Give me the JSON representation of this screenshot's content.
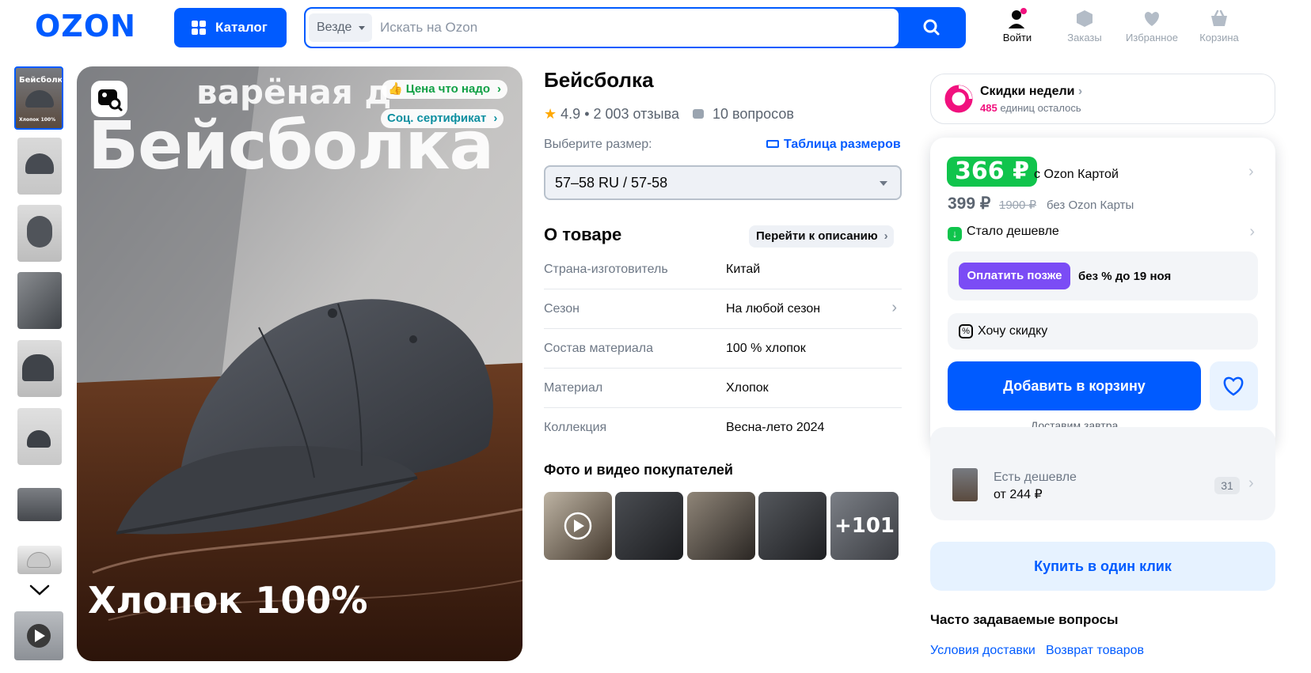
{
  "header": {
    "logo": "OZON",
    "catalog_label": "Каталог",
    "search_scope": "Везде",
    "search_placeholder": "Искать на Ozon",
    "login": "Войти",
    "orders": "Заказы",
    "favorites": "Избранное",
    "cart": "Корзина"
  },
  "gallery": {
    "overlay_line1": "варёная д",
    "overlay_line2": "Бейсболка",
    "overlay_bottom": "Хлопок 100%",
    "pill_price": "Цена что надо",
    "pill_cert": "Соц. сертификат",
    "thumb0_caption1": "Бейсболка",
    "thumb0_caption2": "Хлопок 100%"
  },
  "product": {
    "title": "Бейсболка",
    "rating": "4.9",
    "reviews": "2 003 отзыва",
    "questions": "10 вопросов",
    "size_label": "Выберите размер:",
    "size_table": "Таблица размеров",
    "size_selected": "57–58 RU / 57-58",
    "about_title": "О товаре",
    "to_description": "Перейти к описанию",
    "specs": [
      {
        "k": "Страна-изготовитель",
        "v": "Китай"
      },
      {
        "k": "Сезон",
        "v": "На любой сезон"
      },
      {
        "k": "Состав материала",
        "v": "100 % хлопок"
      },
      {
        "k": "Материал",
        "v": "Хлопок"
      },
      {
        "k": "Коллекция",
        "v": "Весна-лето 2024"
      }
    ],
    "photos_title": "Фото и видео покупателей",
    "photos_more": "+101"
  },
  "buy": {
    "promo_title": "Скидки недели",
    "promo_count": "485",
    "promo_sub": "единиц осталось",
    "price_card": "366 ₽",
    "price_card_label": "с Ozon Картой",
    "price": "399 ₽",
    "price_old": "1900 ₽",
    "price_label": "без Ozon Карты",
    "cheaper_now": "Стало дешевле",
    "pay_later": "Оплатить позже",
    "pay_later_terms": "без % до 19 ноя",
    "want_discount": "Хочу скидку",
    "add_to_cart": "Добавить в корзину",
    "delivery": "Доставим завтра",
    "cheaper_label": "Есть дешевле",
    "cheaper_price": "от 244 ₽",
    "cheaper_count": "31",
    "one_click": "Купить в один клик",
    "faq_title": "Часто задаваемые вопросы",
    "faq_delivery": "Условия доставки",
    "faq_return": "Возврат товаров"
  },
  "colors": {
    "brand": "#005bff",
    "green": "#10c44c",
    "purple": "#7b4cf5",
    "pink": "#f1117e"
  }
}
